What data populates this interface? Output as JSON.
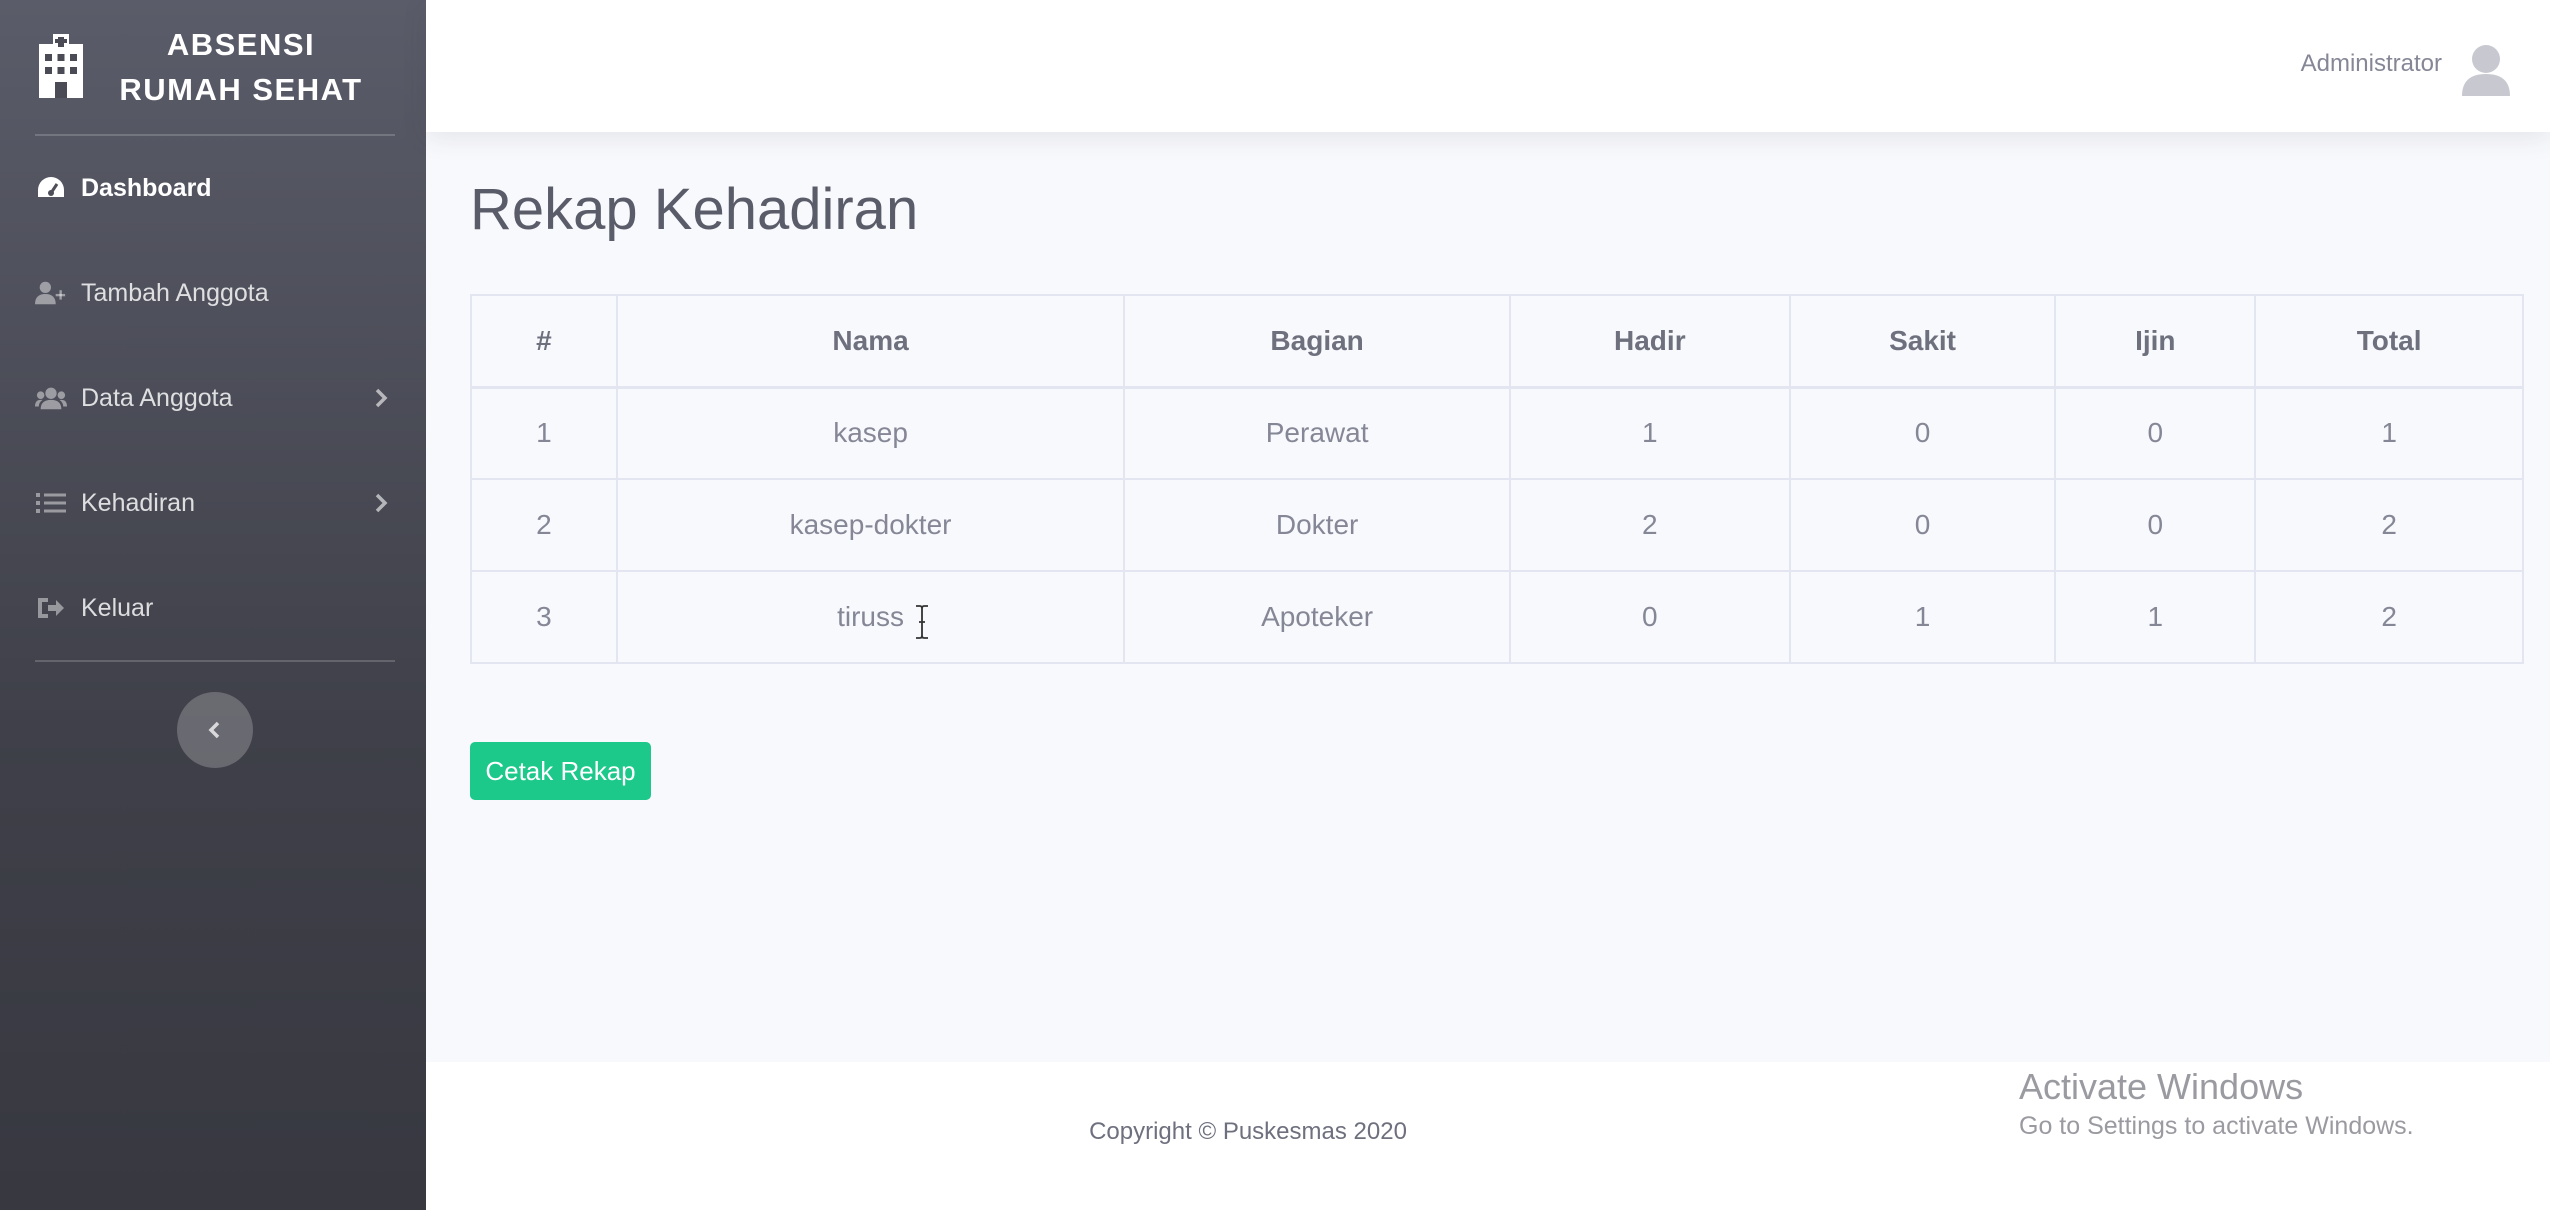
{
  "sidebar": {
    "brand_line1": "ABSENSI",
    "brand_line2": "RUMAH SEHAT",
    "brand_icon": "hospital-icon",
    "items": [
      {
        "label": "Dashboard",
        "icon": "tachometer-icon",
        "active": true
      },
      {
        "label": "Tambah Anggota",
        "icon": "user-plus-icon"
      },
      {
        "label": "Data Anggota",
        "icon": "users-icon",
        "has_submenu": true
      },
      {
        "label": "Kehadiran",
        "icon": "list-icon",
        "has_submenu": true
      },
      {
        "label": "Keluar",
        "icon": "sign-out-icon"
      }
    ],
    "toggle_icon": "chevron-left-icon"
  },
  "topbar": {
    "user_name": "Administrator",
    "avatar_icon": "user-avatar-icon"
  },
  "main": {
    "title": "Rekap Kehadiran",
    "table": {
      "headers": [
        "#",
        "Nama",
        "Bagian",
        "Hadir",
        "Sakit",
        "Ijin",
        "Total"
      ],
      "rows": [
        [
          "1",
          "kasep",
          "Perawat",
          "1",
          "0",
          "0",
          "1"
        ],
        [
          "2",
          "kasep-dokter",
          "Dokter",
          "2",
          "0",
          "0",
          "2"
        ],
        [
          "3",
          "tiruss",
          "Apoteker",
          "0",
          "1",
          "1",
          "2"
        ]
      ]
    },
    "print_button": "Cetak Rekap"
  },
  "footer": {
    "copyright": "Copyright © Puskesmas 2020"
  },
  "watermark": {
    "title": "Activate Windows",
    "subtitle": "Go to Settings to activate Windows."
  },
  "colors": {
    "sidebar_top": "#5a5c69",
    "sidebar_bottom": "#373840",
    "accent_success": "#1cc88a",
    "text_muted": "#858796"
  }
}
